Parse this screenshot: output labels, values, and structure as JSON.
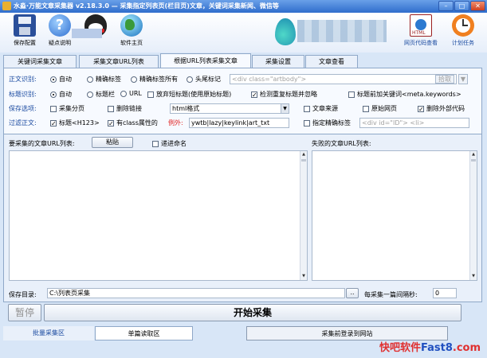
{
  "window": {
    "title": "水淼·万能文章采集器 v2.18.3.0 — 采集指定列表页(栏目页)文章，关键词采集新闻、微信等"
  },
  "toolbar": {
    "save_config": "保存配置",
    "help": "疑点说明",
    "site": "软件主页",
    "html_view": "网页代码查看",
    "schedule": "计划任务"
  },
  "tabs": [
    "关键词采集文章",
    "采集文章URL列表",
    "根据URL列表采集文章",
    "采集设置",
    "文章查看"
  ],
  "body_recog": {
    "label": "正文识别:",
    "opts": [
      "自动",
      "精确标签",
      "精确标签所有",
      "头尾标记"
    ],
    "input": "<div class=\"artbody\">",
    "btn": "拾取"
  },
  "title_recog": {
    "label": "标题识别:",
    "opts": [
      "自动",
      "标题栏",
      "URL",
      "放弃短标题(使用原始标题)",
      "检测重复标题并忽略",
      "标题前加关键词<meta.keywords>"
    ]
  },
  "save_opts": {
    "label": "保存选项:",
    "opts": [
      "采集分页",
      "删除链接"
    ],
    "format": "html格式",
    "opts2": [
      "文章来源",
      "原始网页",
      "删除外部代码"
    ]
  },
  "filter": {
    "label": "过滤正文:",
    "opts": [
      "标题<H123>",
      "有class属性的"
    ],
    "except_label": "例外:",
    "except_value": "ywtb|lazy|keylink|art_txt",
    "precise_tag": "指定精确标签",
    "tag_placeholder": "<div id=\"ID\">",
    "tag_placeholder2": "<li>"
  },
  "mid": {
    "url_list_label": "要采集的文章URL列表:",
    "paste_btn": "粘贴",
    "rename": "递进命名",
    "failed_label": "失败的文章URL列表:",
    "save_dir_label": "保存目录:",
    "save_dir": "C:\\列表页采集",
    "browse_btn": "..",
    "interval_label": "每采集一篇间隔秒:",
    "interval": "0",
    "pause_btn": "暂停",
    "start_btn": "开始采集"
  },
  "bottom_tabs": [
    "批量采集区",
    "单篇读取区",
    "采集前登录到网站"
  ],
  "watermark": {
    "text1": "快吧软件",
    "text2": "Fast8",
    "text3": ".com"
  },
  "colors": {
    "accent": "#1a4aa0",
    "panel": "#f7faff",
    "bg": "#d8e6f7"
  }
}
